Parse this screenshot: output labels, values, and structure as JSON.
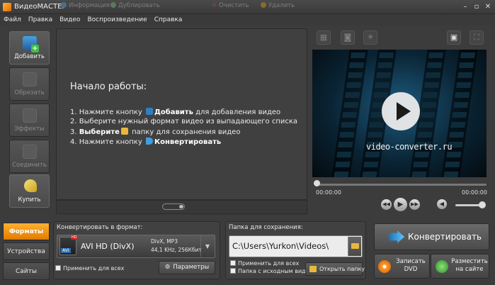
{
  "window": {
    "title": "ВидеоМАСТЕР",
    "minimize": "–",
    "restore": "▫",
    "close": "✕"
  },
  "menu": [
    "Файл",
    "Правка",
    "Видео",
    "Воспроизведение",
    "Справка"
  ],
  "tools": [
    {
      "label": "Добавить",
      "icon": "add-video-icon"
    },
    {
      "label": "Обрезать",
      "icon": "trim-icon"
    },
    {
      "label": "Эффекты",
      "icon": "effects-icon"
    },
    {
      "label": "Соединить",
      "icon": "join-icon"
    },
    {
      "label": "Купить",
      "icon": "key-icon"
    }
  ],
  "start": {
    "title": "Начало работы:",
    "steps": [
      {
        "pre": "1. Нажмите кнопку ",
        "bold": "Добавить",
        "post": " для добавления видео"
      },
      {
        "pre": "2. Выберите нужный формат видео из выпадающего списка",
        "bold": "",
        "post": ""
      },
      {
        "pre": "3. ",
        "bold": "Выберите",
        "post": " папку для сохранения видео"
      },
      {
        "pre": "4. Нажмите кнопку ",
        "bold": "Конвертировать",
        "post": ""
      }
    ]
  },
  "main_toolbar": {
    "info": "Информация",
    "duplicate": "Дублировать",
    "clear": "Очистить",
    "delete": "Удалить"
  },
  "preview": {
    "site": "video-converter.ru",
    "time_start": "00:00:00",
    "time_end": "00:00:00",
    "volume_level": 0.8
  },
  "bottom_tabs": [
    "Форматы",
    "Устройства",
    "Сайты"
  ],
  "format": {
    "label": "Конвертировать в формат:",
    "name": "AVI HD (DivX)",
    "codec": "DivX, MP3",
    "audio": "44,1 KHz, 256Кбит",
    "badge": "AVI",
    "hd": "HD",
    "apply_all": "Применить для всех",
    "params": "Параметры"
  },
  "save": {
    "label": "Папка для сохранения:",
    "path": "C:\\Users\\Yurkon\\Videos\\",
    "apply_all": "Применить для всех",
    "source_folder": "Папка с исходным видео",
    "open_folder": "Открыть папку"
  },
  "actions": {
    "convert": "Конвертировать",
    "burn_line1": "Записать",
    "burn_line2": "DVD",
    "upload_line1": "Разместить",
    "upload_line2": "на сайте"
  },
  "colors": {
    "accent": "#f39a10",
    "video_bg": "#0a2434"
  }
}
